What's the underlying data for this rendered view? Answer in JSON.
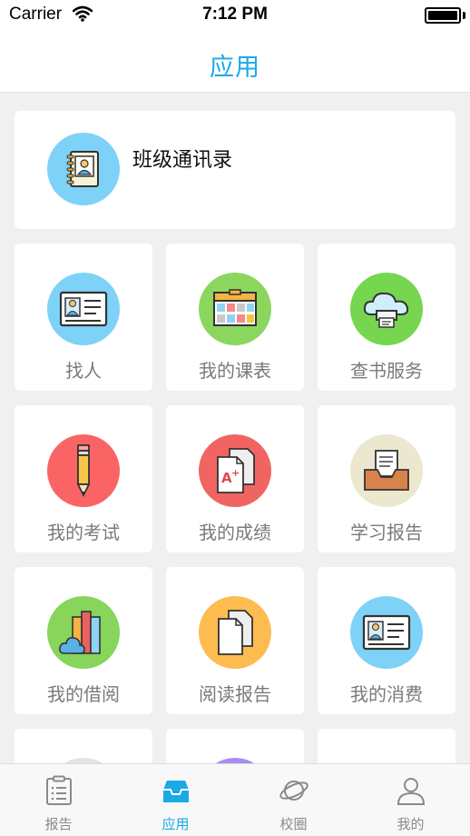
{
  "status_bar": {
    "carrier": "Carrier",
    "time": "7:12 PM"
  },
  "nav": {
    "title": "应用"
  },
  "wide_card": {
    "label": "班级通讯录",
    "icon": "address-book-icon",
    "color": "#7ed2f7"
  },
  "tiles": [
    {
      "label": "找人",
      "icon": "id-card-icon",
      "color": "#7ed2f7"
    },
    {
      "label": "我的课表",
      "icon": "timetable-icon",
      "color": "#8cd65f"
    },
    {
      "label": "查书服务",
      "icon": "cloud-print-icon",
      "color": "#76d64f"
    },
    {
      "label": "我的考试",
      "icon": "pencil-icon",
      "color": "#fb6464"
    },
    {
      "label": "我的成绩",
      "icon": "grade-document-icon",
      "color": "#f06561"
    },
    {
      "label": "学习报告",
      "icon": "report-tray-icon",
      "color": "#ece7cf"
    },
    {
      "label": "我的借阅",
      "icon": "books-icon",
      "color": "#87d55b"
    },
    {
      "label": "阅读报告",
      "icon": "documents-icon",
      "color": "#fcbc4f"
    },
    {
      "label": "我的消费",
      "icon": "id-card-icon",
      "color": "#7ed2f7"
    }
  ],
  "partial_tiles": [
    {
      "color": "#e3e3e3"
    },
    {
      "color": "#a78cf5"
    },
    {
      "color": "#ffffff"
    }
  ],
  "tabbar": {
    "items": [
      {
        "label": "报告",
        "icon": "clipboard-icon",
        "active": false
      },
      {
        "label": "应用",
        "icon": "inbox-tray-icon",
        "active": true
      },
      {
        "label": "校圈",
        "icon": "planet-icon",
        "active": false
      },
      {
        "label": "我的",
        "icon": "person-icon",
        "active": false
      }
    ]
  }
}
